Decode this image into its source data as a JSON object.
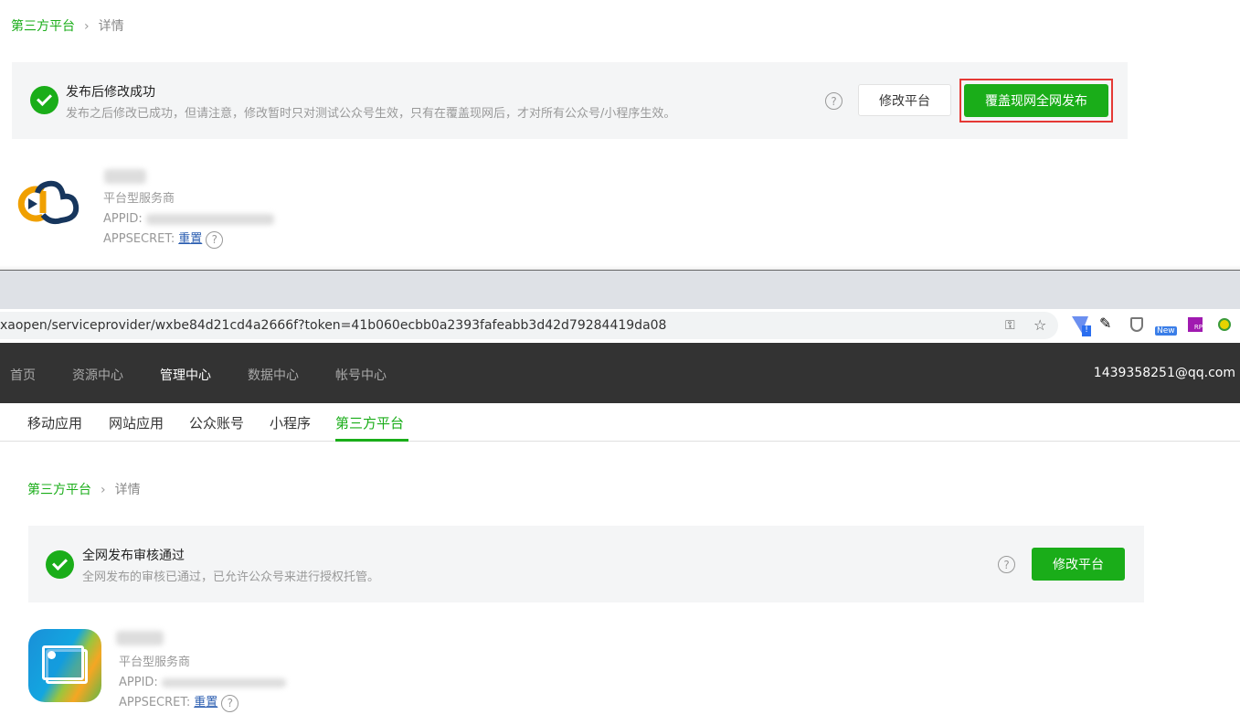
{
  "top": {
    "breadcrumb": {
      "parent": "第三方平台",
      "current": "详情"
    },
    "banner": {
      "title": "发布后修改成功",
      "desc": "发布之后修改已成功，但请注意，修改暂时只对测试公众号生效，只有在覆盖现网后，才对所有公众号/小程序生效。",
      "help": "?",
      "edit_label": "修改平台",
      "publish_label": "覆盖现网全网发布"
    },
    "app": {
      "type": "平台型服务商",
      "appid_label": "APPID:",
      "appsecret_label": "APPSECRET:",
      "reset_label": "重置",
      "help": "?"
    }
  },
  "browser": {
    "url": "xaopen/serviceprovider/wxbe84d21cd4a2666f?token=41b060ecbb0a2393fafeabb3d42d79284419da08",
    "ext_new": "New",
    "ext_rp": "RP"
  },
  "nav": {
    "items": [
      "首页",
      "资源中心",
      "管理中心",
      "数据中心",
      "帐号中心"
    ],
    "user": "1439358251@qq.com"
  },
  "subnav": {
    "items": [
      "移动应用",
      "网站应用",
      "公众账号",
      "小程序",
      "第三方平台"
    ]
  },
  "bottom": {
    "breadcrumb": {
      "parent": "第三方平台",
      "current": "详情"
    },
    "banner": {
      "title": "全网发布审核通过",
      "desc": "全网发布的审核已通过，已允许公众号来进行授权托管。",
      "help": "?",
      "edit_label": "修改平台"
    },
    "app": {
      "type": "平台型服务商",
      "appid_label": "APPID:",
      "appsecret_label": "APPSECRET:",
      "reset_label": "重置",
      "help": "?"
    }
  }
}
